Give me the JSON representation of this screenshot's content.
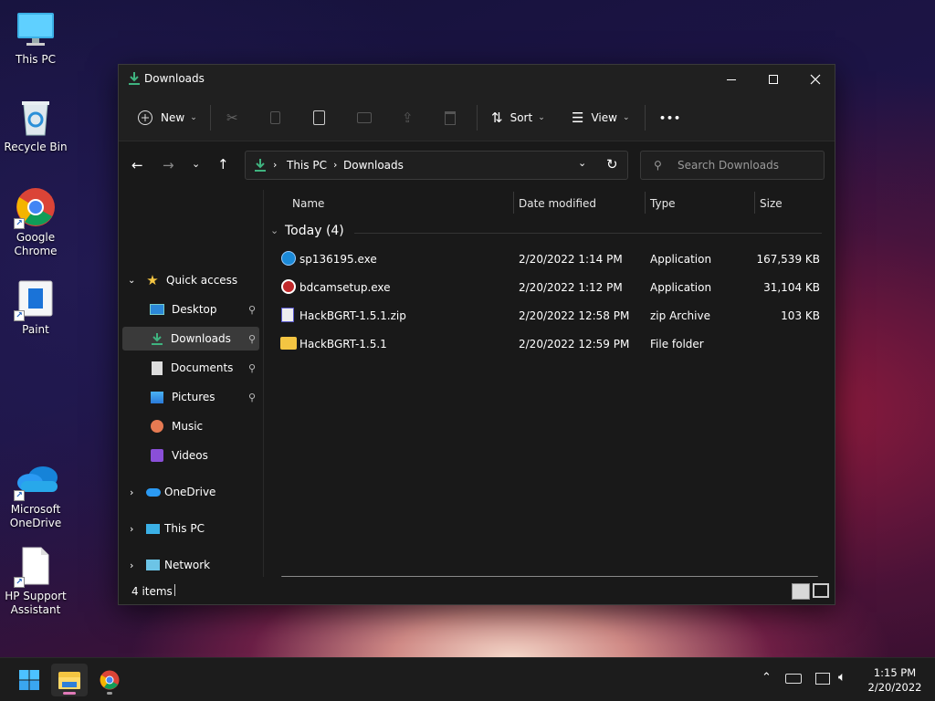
{
  "desktop": {
    "icons": [
      {
        "label": "This PC",
        "icon": "monitor-icon"
      },
      {
        "label": "Recycle Bin",
        "icon": "recycle-bin-icon"
      },
      {
        "label": "Google Chrome",
        "icon": "chrome-icon"
      },
      {
        "label": "Paint",
        "icon": "paint-icon"
      },
      {
        "label": "Microsoft OneDrive",
        "icon": "onedrive-icon"
      },
      {
        "label": "HP Support Assistant",
        "icon": "document-icon"
      }
    ]
  },
  "window": {
    "title": "Downloads"
  },
  "toolbar": {
    "new_label": "New",
    "sort_label": "Sort",
    "view_label": "View",
    "more_label": "•••"
  },
  "address": {
    "root": "This PC",
    "current": "Downloads",
    "search_placeholder": "Search Downloads"
  },
  "nav": {
    "quick_access": "Quick access",
    "items": [
      {
        "label": "Desktop",
        "pinned": true
      },
      {
        "label": "Downloads",
        "pinned": true,
        "selected": true
      },
      {
        "label": "Documents",
        "pinned": true
      },
      {
        "label": "Pictures",
        "pinned": true
      },
      {
        "label": "Music",
        "pinned": false
      },
      {
        "label": "Videos",
        "pinned": false
      }
    ],
    "onedrive": "OneDrive",
    "thispc": "This PC",
    "network": "Network"
  },
  "columns": {
    "name": "Name",
    "date": "Date modified",
    "type": "Type",
    "size": "Size"
  },
  "group": {
    "label": "Today (4)"
  },
  "files": [
    {
      "name": "sp136195.exe",
      "date": "2/20/2022 1:14 PM",
      "type": "Application",
      "size": "167,539 KB",
      "icon": "hp-app-icon"
    },
    {
      "name": "bdcamsetup.exe",
      "date": "2/20/2022 1:12 PM",
      "type": "Application",
      "size": "31,104 KB",
      "icon": "bandicam-icon"
    },
    {
      "name": "HackBGRT-1.5.1.zip",
      "date": "2/20/2022 12:58 PM",
      "type": "zip Archive",
      "size": "103 KB",
      "icon": "zip-icon"
    },
    {
      "name": "HackBGRT-1.5.1",
      "date": "2/20/2022 12:59 PM",
      "type": "File folder",
      "size": "",
      "icon": "folder-icon"
    }
  ],
  "status": {
    "count": "4 items"
  },
  "taskbar": {
    "time": "1:15 PM",
    "date": "2/20/2022"
  },
  "colors": {
    "accent": "#3fb37f",
    "folder": "#f4c542",
    "selection": "#3a3a3a"
  }
}
